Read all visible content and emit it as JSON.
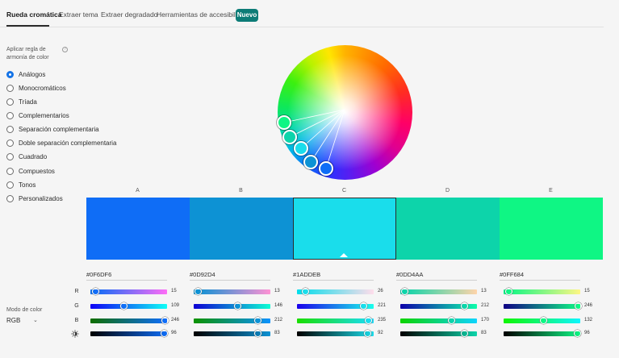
{
  "tabs": [
    {
      "label": "Rueda cromática",
      "active": true
    },
    {
      "label": "Extraer tema",
      "active": false
    },
    {
      "label": "Extraer degradado",
      "active": false
    },
    {
      "label": "Herramientas de accesibilidad",
      "active": false
    }
  ],
  "new_badge": "Nuevo",
  "harmony": {
    "title": "Aplicar regla de armonía de color",
    "help_icon": "info-icon",
    "options": [
      {
        "label": "Análogos",
        "checked": true
      },
      {
        "label": "Monocromáticos",
        "checked": false
      },
      {
        "label": "Tríada",
        "checked": false
      },
      {
        "label": "Complementarios",
        "checked": false
      },
      {
        "label": "Separación complementaria",
        "checked": false
      },
      {
        "label": "Doble separación complementaria",
        "checked": false
      },
      {
        "label": "Cuadrado",
        "checked": false
      },
      {
        "label": "Compuestos",
        "checked": false
      },
      {
        "label": "Tonos",
        "checked": false
      },
      {
        "label": "Personalizados",
        "checked": false
      }
    ]
  },
  "color_mode": {
    "label": "Modo de color",
    "value": "RGB"
  },
  "row_labels": {
    "r": "R",
    "g": "G",
    "b": "B",
    "brightness_icon": "sun-brightness-icon"
  },
  "swatches": [
    {
      "letter": "A",
      "hex": "#0F6DF6",
      "color": "#0F6DF6",
      "selected": false,
      "r": 15,
      "g": 109,
      "b": 246,
      "brightness": 96
    },
    {
      "letter": "B",
      "hex": "#0D92D4",
      "color": "#0D92D4",
      "selected": false,
      "r": 13,
      "g": 146,
      "b": 212,
      "brightness": 83
    },
    {
      "letter": "C",
      "hex": "#1ADDEB",
      "color": "#1ADDEB",
      "selected": true,
      "r": 26,
      "g": 221,
      "b": 235,
      "brightness": 92
    },
    {
      "letter": "D",
      "hex": "#0DD4AA",
      "color": "#0DD4AA",
      "selected": false,
      "r": 13,
      "g": 212,
      "b": 170,
      "brightness": 83
    },
    {
      "letter": "E",
      "hex": "#0FF684",
      "color": "#0FF684",
      "selected": false,
      "r": 15,
      "g": 246,
      "b": 132,
      "brightness": 96
    }
  ]
}
